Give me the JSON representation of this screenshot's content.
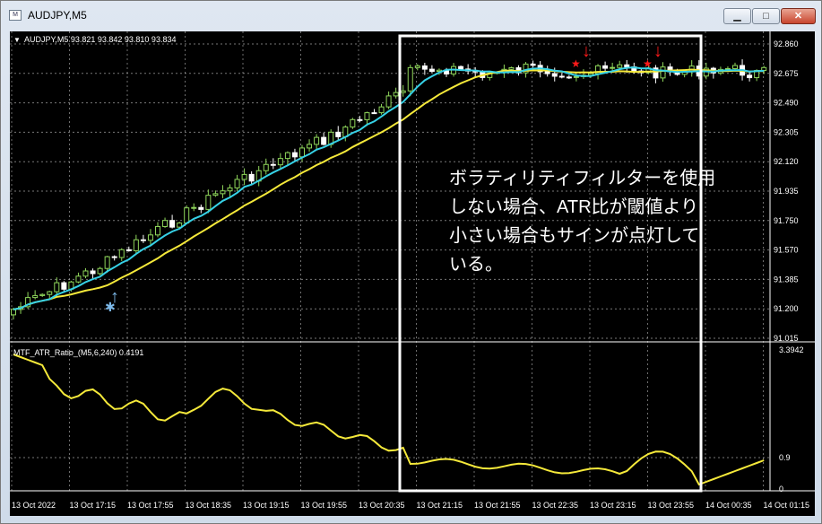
{
  "window": {
    "title": "AUDJPY,M5",
    "app_icon": "chart-window-icon",
    "buttons": {
      "minimize": "▁",
      "maximize": "□",
      "close": "✕"
    }
  },
  "main_chart": {
    "header_arrow": "▼",
    "symbol_info": "AUDJPY,M5  93.821 93.842 93.810 93.834",
    "price_labels": [
      "92.860",
      "92.675",
      "92.490",
      "92.305",
      "92.120",
      "91.935",
      "91.750",
      "91.570",
      "91.385",
      "91.200",
      "91.015"
    ]
  },
  "sub_chart": {
    "indicator_label": "MTF_ATR_Ratio_(M5,6,240) 0.4191",
    "scale_labels": [
      "3.3942",
      "0.9",
      "0"
    ]
  },
  "time_labels": [
    "13 Oct 2022",
    "13 Oct 17:15",
    "13 Oct 17:55",
    "13 Oct 18:35",
    "13 Oct 19:15",
    "13 Oct 19:55",
    "13 Oct 20:35",
    "13 Oct 21:15",
    "13 Oct 21:55",
    "13 Oct 22:35",
    "13 Oct 23:15",
    "13 Oct 23:55",
    "14 Oct 00:35",
    "14 Oct 01:15"
  ],
  "annotation": {
    "lines": [
      "ボラティリティフィルターを使用",
      "しない場合、ATR比が閾値より",
      "小さい場合もサインが点灯して",
      "いる。"
    ]
  },
  "signals": {
    "buy": {
      "arrow": "↑",
      "marker": "✱"
    },
    "sells": [
      {
        "arrow": "↓",
        "marker": "★"
      },
      {
        "arrow": "↓",
        "marker": "★"
      }
    ]
  },
  "colors": {
    "background": "#000000",
    "grid": "#c8c8c8",
    "bull_candle": "#8fd65b",
    "bear_candle": "#ffffff",
    "fast_ma": "#36d1e6",
    "slow_ma": "#f5e93a",
    "atr_line": "#f5e93a",
    "buy_signal": "#7cb8e8",
    "sell_signal": "#ff1a1a",
    "annotation_box": "#ffffff"
  }
}
